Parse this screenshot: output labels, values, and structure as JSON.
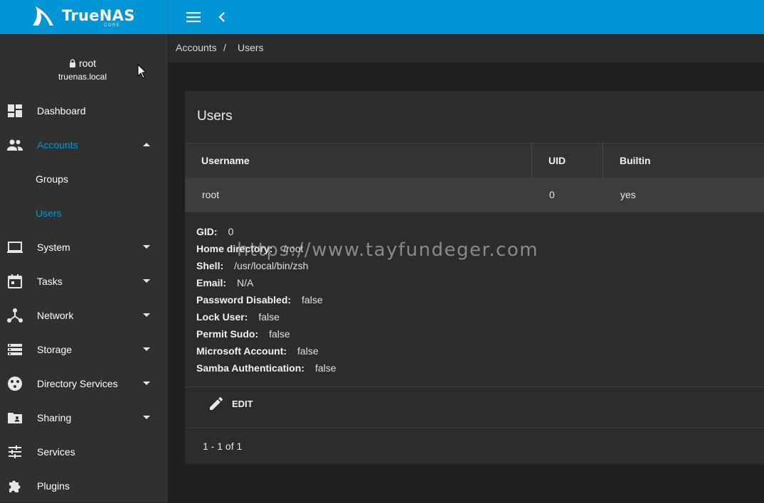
{
  "app": {
    "logo_text": "TrueNAS",
    "logo_sub": "CORE",
    "brand_color": "#0095d5"
  },
  "user": {
    "name": "root",
    "host": "truenas.local"
  },
  "sidebar": {
    "items": [
      {
        "label": "Dashboard",
        "icon": "dashboard-icon"
      },
      {
        "label": "Accounts",
        "icon": "people-icon",
        "expanded": true,
        "active": true
      },
      {
        "label": "Groups",
        "sub": true
      },
      {
        "label": "Users",
        "sub": true,
        "active": true
      },
      {
        "label": "System",
        "icon": "laptop-icon"
      },
      {
        "label": "Tasks",
        "icon": "calendar-icon"
      },
      {
        "label": "Network",
        "icon": "network-icon"
      },
      {
        "label": "Storage",
        "icon": "storage-icon"
      },
      {
        "label": "Directory Services",
        "icon": "directory-icon"
      },
      {
        "label": "Sharing",
        "icon": "shared-folder-icon"
      },
      {
        "label": "Services",
        "icon": "tune-icon"
      },
      {
        "label": "Plugins",
        "icon": "puzzle-icon"
      }
    ]
  },
  "breadcrumb": {
    "parent": "Accounts",
    "separator": "/",
    "current": "Users"
  },
  "users_card": {
    "title": "Users",
    "columns": [
      "Username",
      "UID",
      "Builtin"
    ],
    "rows": [
      {
        "username": "root",
        "uid": "0",
        "builtin": "yes"
      }
    ],
    "details": [
      {
        "key": "GID:",
        "value": "0"
      },
      {
        "key": "Home directory:",
        "value": "/root"
      },
      {
        "key": "Shell:",
        "value": "/usr/local/bin/zsh"
      },
      {
        "key": "Email:",
        "value": "N/A"
      },
      {
        "key": "Password Disabled:",
        "value": "false"
      },
      {
        "key": "Lock User:",
        "value": "false"
      },
      {
        "key": "Permit Sudo:",
        "value": "false"
      },
      {
        "key": "Microsoft Account:",
        "value": "false"
      },
      {
        "key": "Samba Authentication:",
        "value": "false"
      }
    ],
    "edit_label": "EDIT",
    "paginator": "1 - 1 of 1"
  },
  "watermark": "https://www.tayfundeger.com"
}
